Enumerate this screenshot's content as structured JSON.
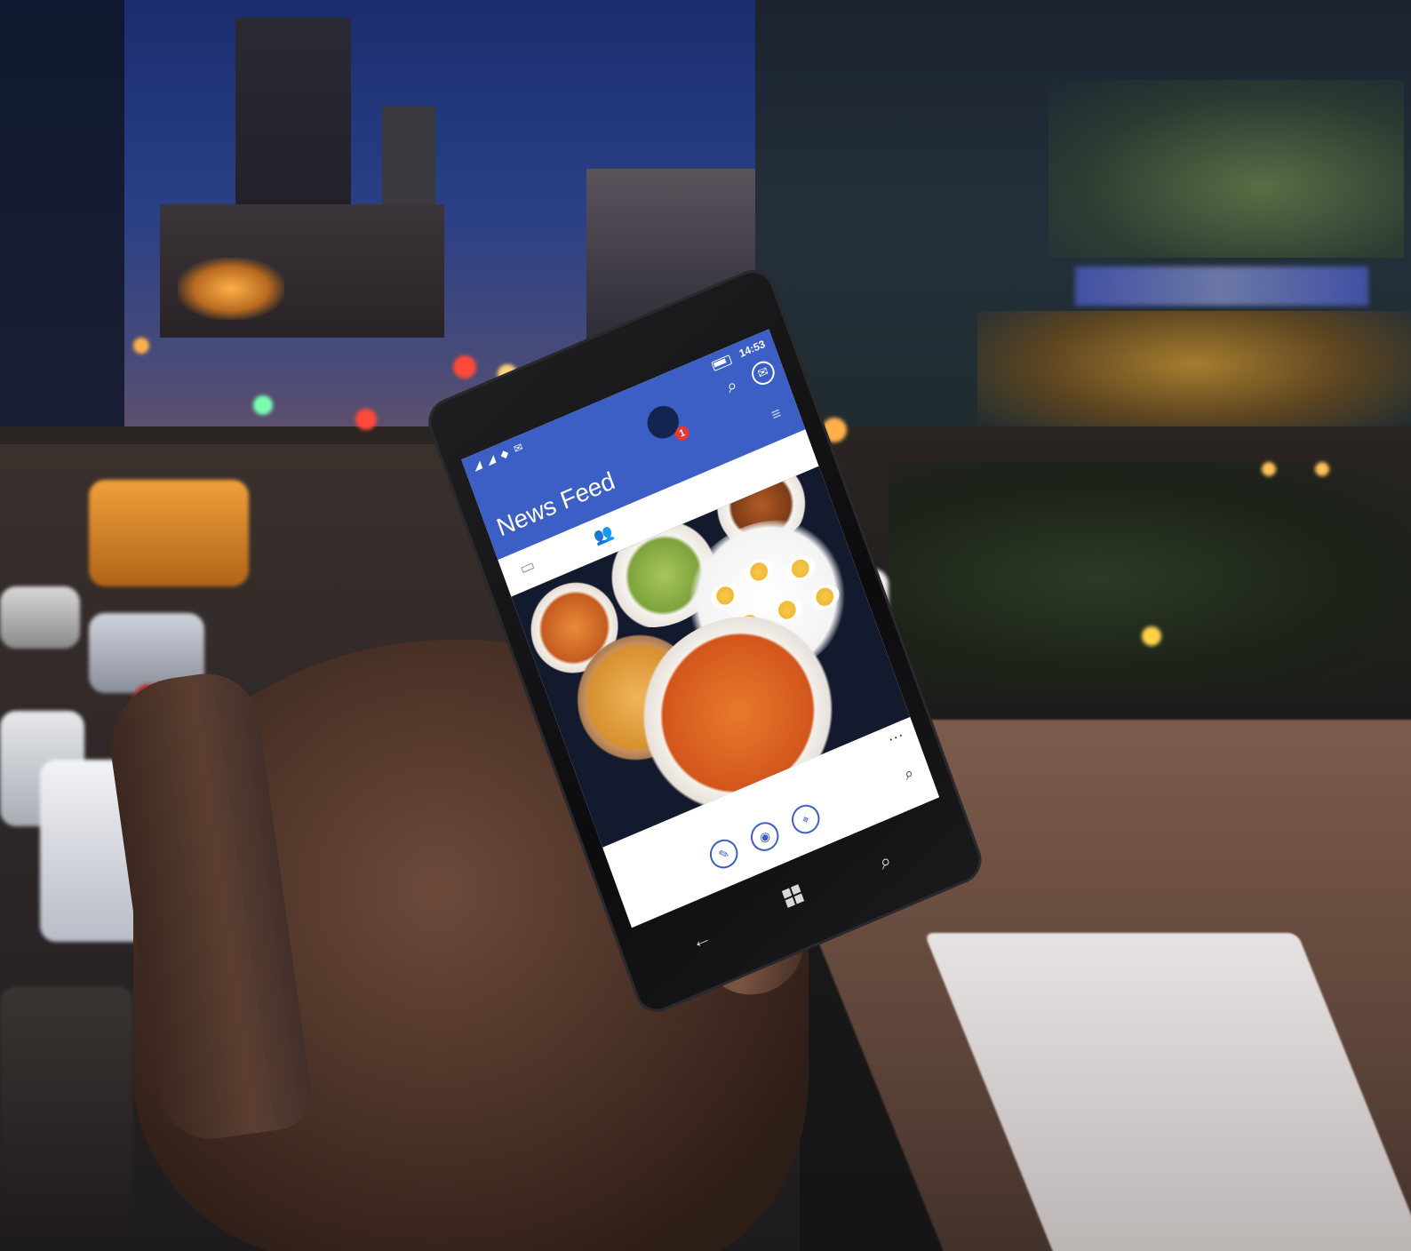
{
  "status_bar": {
    "signal_icons": "◢ ◢ ◆ ✉",
    "time": "14:53"
  },
  "app": {
    "title": "News Feed",
    "notification_count": "1"
  },
  "icons": {
    "search": "⌕",
    "messenger": "✉",
    "menu": "≡",
    "friends": "👥",
    "feed": "▭",
    "more": "···",
    "status": "✎",
    "camera": "◉",
    "checkin": "⌖",
    "back": "←",
    "phone_search": "⌕"
  },
  "colors": {
    "facebook_blue": "#3b5fc4",
    "badge_red": "#e53935"
  }
}
